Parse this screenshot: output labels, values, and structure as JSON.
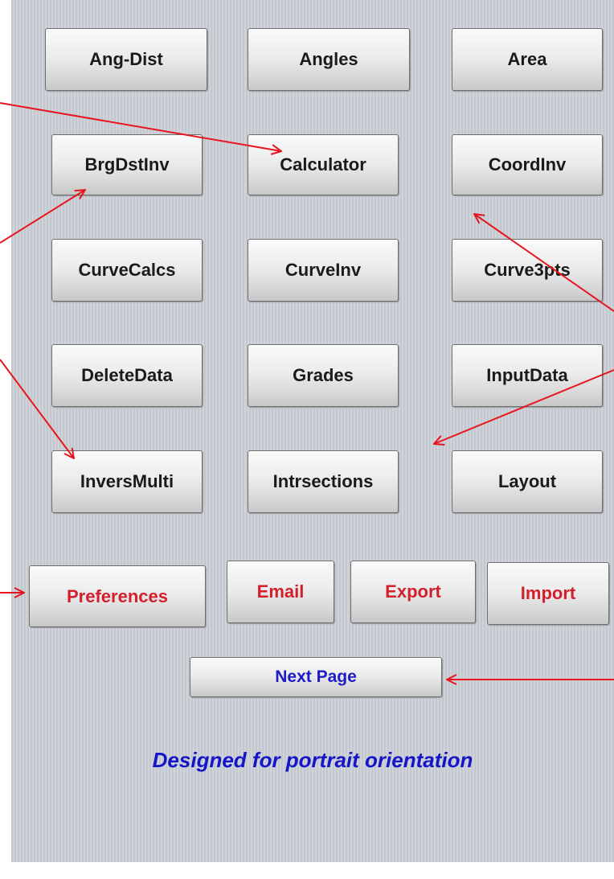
{
  "buttons": {
    "ang_dist": "Ang-Dist",
    "angles": "Angles",
    "area": "Area",
    "brgdstinv": "BrgDstInv",
    "calculator": "Calculator",
    "coordinv": "CoordInv",
    "curvecalcs": "CurveCalcs",
    "curveinv": "CurveInv",
    "curve3pts": "Curve3pts",
    "deletedata": "DeleteData",
    "grades": "Grades",
    "inputdata": "InputData",
    "inversmulti": "InversMulti",
    "intrsections": "Intrsections",
    "layout": "Layout",
    "preferences": "Preferences",
    "email": "Email",
    "export": "Export",
    "import": "Import",
    "next_page": "Next Page"
  },
  "tagline": "Designed for portrait orientation",
  "colors": {
    "panel_bg": "#c7ccd2",
    "function_text": "#1a1a1a",
    "settings_text": "#d21f2b",
    "nav_text": "#1c1cc8",
    "annotation_arrow": "#e8141e"
  }
}
